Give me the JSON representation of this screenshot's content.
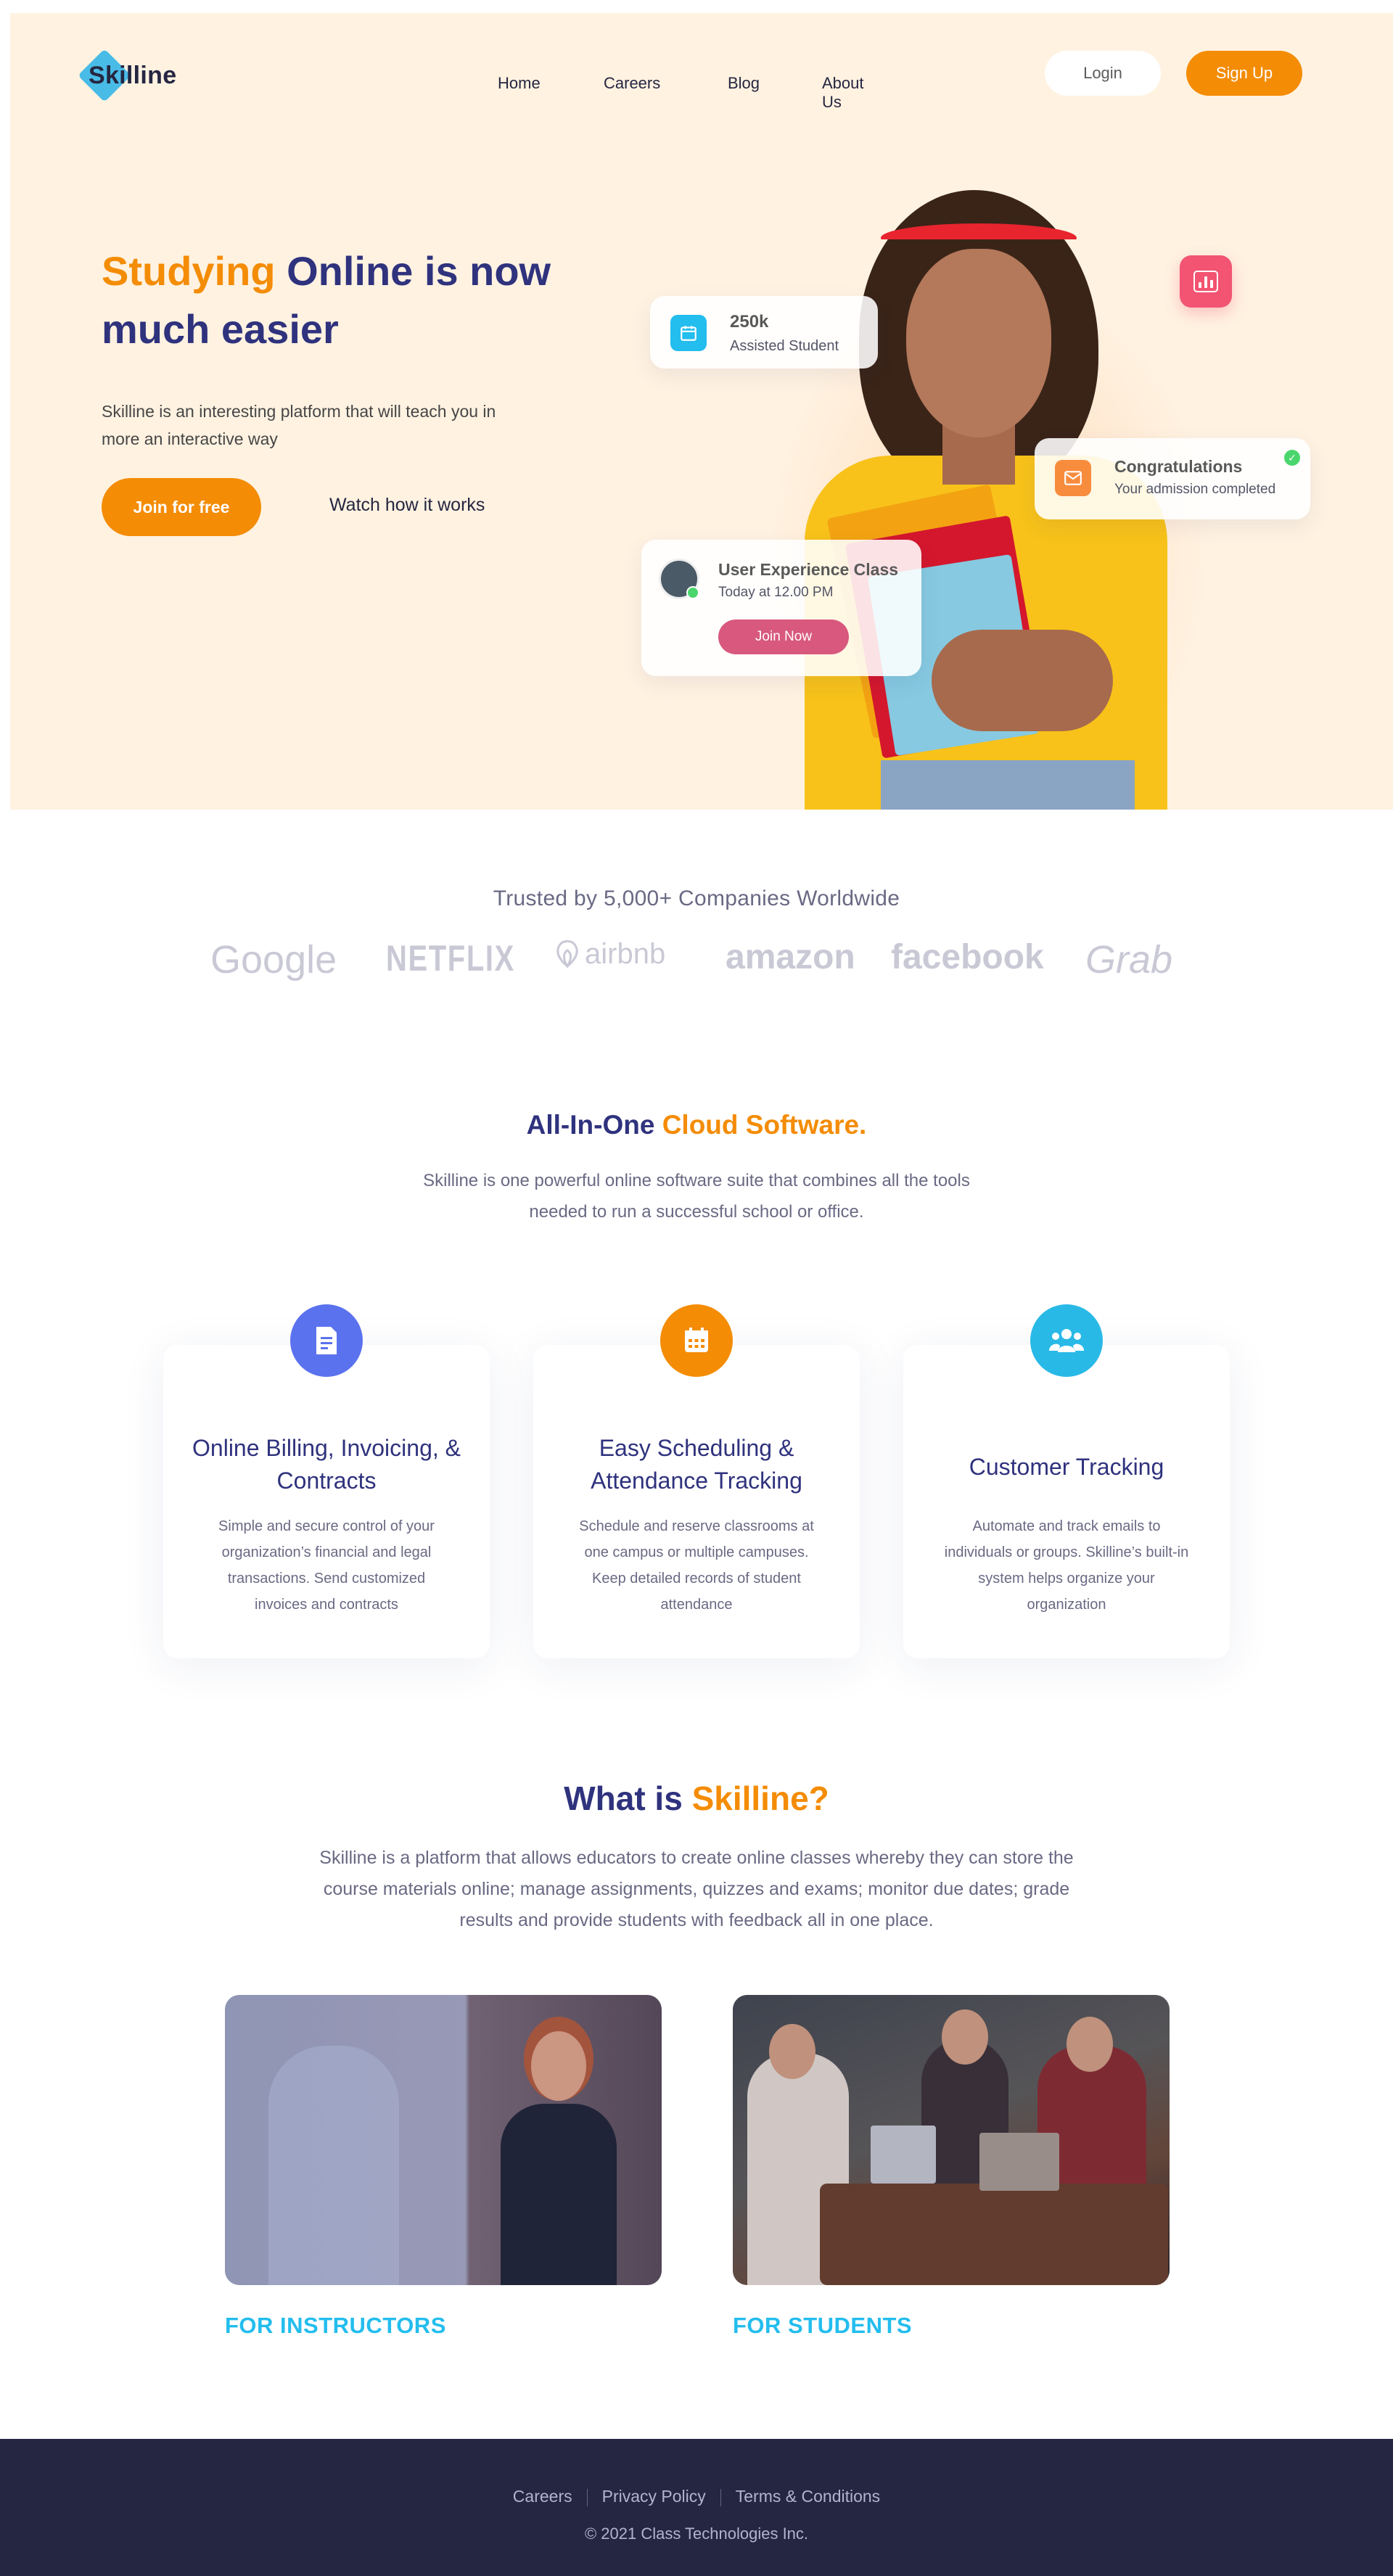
{
  "brand": {
    "name": "Skilline",
    "accent": "#f48c06",
    "navy": "#2f327d",
    "hero_bg": "#fff2e1"
  },
  "nav": {
    "items": [
      "Home",
      "Careers",
      "Blog",
      "About Us"
    ],
    "login": "Login",
    "signup": "Sign Up"
  },
  "hero": {
    "title_accent": "Studying",
    "title_rest": " Online is now much easier",
    "subtitle": "Skilline is an interesting platform that will teach you in more an interactive way",
    "cta_primary": "Join for free",
    "cta_secondary": "Watch how it works",
    "stat_card": {
      "value": "250k",
      "label": "Assisted Student",
      "icon": "calendar-icon"
    },
    "congrats_card": {
      "title": "Congratulations",
      "subtitle": "Your admission completed",
      "icon": "mail-icon"
    },
    "class_card": {
      "title": "User Experience Class",
      "time": "Today at 12.00 PM",
      "button": "Join Now"
    }
  },
  "trusted": {
    "title": "Trusted by 5,000+ Companies Worldwide",
    "logos": [
      "Google",
      "NETFLIX",
      "airbnb",
      "amazon",
      "facebook",
      "Grab"
    ]
  },
  "cloud": {
    "title_main": "All-In-One ",
    "title_accent": "Cloud Software.",
    "description": "Skilline is one powerful online software suite that combines all the tools needed to run a successful school or office.",
    "features": [
      {
        "title": "Online Billing, Invoicing, & Contracts",
        "description": "Simple and secure control of your organization’s financial and legal transactions. Send customized invoices and contracts",
        "icon": "document-icon",
        "color": "#5b72ee"
      },
      {
        "title": "Easy Scheduling & Attendance Tracking",
        "description": "Schedule and reserve classrooms at one campus or multiple campuses. Keep detailed records of student attendance",
        "icon": "calendar-icon",
        "color": "#f48c06"
      },
      {
        "title": "Customer Tracking",
        "description": "Automate and track emails to individuals or groups. Skilline’s built-in system helps organize your organization",
        "icon": "users-icon",
        "color": "#29b9e7"
      }
    ]
  },
  "what_is": {
    "title_main": "What is ",
    "title_accent": "Skilline?",
    "description": "Skilline is a platform that allows educators to create online classes whereby they can store the course materials online; manage assignments, quizzes and exams; monitor due dates; grade results and provide students with feedback all in one place.",
    "cards": [
      {
        "label": "FOR INSTRUCTORS"
      },
      {
        "label": "FOR STUDENTS"
      }
    ]
  },
  "footer": {
    "links": [
      "Careers",
      "Privacy Policy",
      "Terms & Conditions"
    ],
    "copyright": "© 2021 Class Technologies Inc."
  }
}
